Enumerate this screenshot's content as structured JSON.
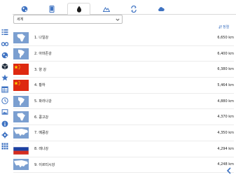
{
  "colors": {
    "accent": "#3f73c2",
    "text": "#222222"
  },
  "tabs": [
    {
      "icon": "globe-icon",
      "active": false
    },
    {
      "icon": "tablet-icon",
      "active": false
    },
    {
      "icon": "water-drop-icon",
      "active": true
    },
    {
      "icon": "mountains-icon",
      "active": false
    },
    {
      "icon": "exchange-icon",
      "active": false
    },
    {
      "icon": "cloud-icon",
      "active": false
    }
  ],
  "sidebar": [
    "list-icon",
    "binoculars-icon",
    "globe-icon",
    "cube-icon",
    "star-icon",
    "table-icon",
    "clock-icon",
    "image-icon",
    "info-icon",
    "gear-icon",
    "grid-icon"
  ],
  "filter": {
    "selected": "세계"
  },
  "sort": {
    "label": "정렬"
  },
  "rivers": [
    {
      "name": "1. 나일강",
      "length": "6,650 km",
      "thumb": "africa"
    },
    {
      "name": "2. 아마존강",
      "length": "6,400 km",
      "thumb": "south-america"
    },
    {
      "name": "3. 양 강",
      "length": "6,380 km",
      "thumb": "china-flag"
    },
    {
      "name": "4. 황하",
      "length": "5,464 km",
      "thumb": "china-flag"
    },
    {
      "name": "5. 파라나강",
      "length": "4,880 km",
      "thumb": "south-america"
    },
    {
      "name": "6. 콩고강",
      "length": "4,370 km",
      "thumb": "africa"
    },
    {
      "name": "7. 메콩강",
      "length": "4,350 km",
      "thumb": "asia"
    },
    {
      "name": "8. 레나강",
      "length": "4,294 km",
      "thumb": "russia-flag"
    },
    {
      "name": "9. 이르티시강",
      "length": "4,248 km",
      "thumb": "asia"
    }
  ]
}
